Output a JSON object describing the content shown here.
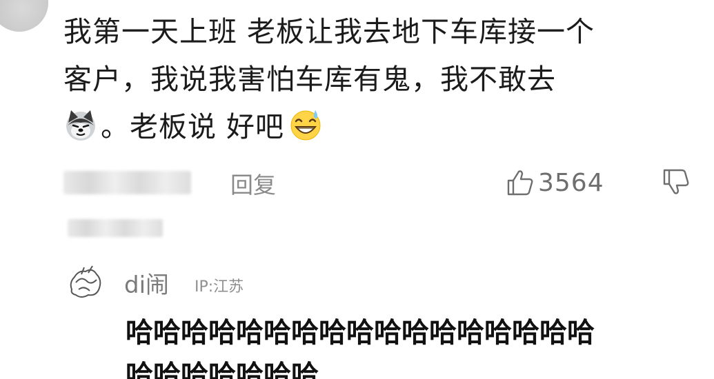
{
  "comment": {
    "text_line1": "我第一天上班 老板让我去地下车库接一个",
    "text_line2": "客户，我说我害怕车库有鬼，我不敢去",
    "text_line3_a": "。老板说 好吧",
    "emoji_1": "husky-emoji",
    "emoji_2": "sweat-smile-emoji"
  },
  "actions": {
    "reply_label": "回复",
    "like_count": "3564",
    "like_icon": "thumbs-up-icon",
    "dislike_icon": "thumbs-down-icon"
  },
  "reply": {
    "username": "di闹",
    "ip": "IP:江苏",
    "text_line1": "哈哈哈哈哈哈哈哈哈哈哈哈哈哈哈哈哈",
    "text_line2": "哈哈哈哈哈哈哈"
  },
  "colors": {
    "text": "#1b1b1b",
    "meta": "#8a8a8a",
    "background": "#ffffff"
  }
}
